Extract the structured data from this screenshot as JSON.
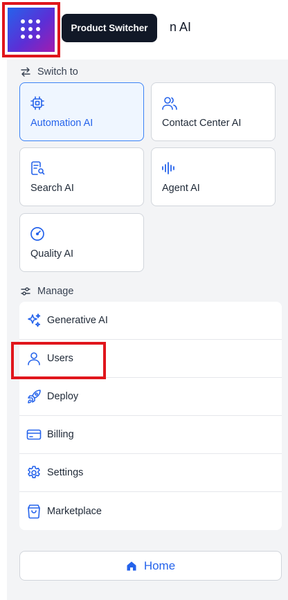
{
  "header": {
    "title_fragment": "n AI",
    "switcher_icon": "grid-dots-icon",
    "tooltip": "Product Switcher"
  },
  "switch_to": {
    "heading": "Switch to",
    "icon": "swap-arrows-icon",
    "products": [
      {
        "label": "Automation AI",
        "icon": "chip-icon",
        "active": true
      },
      {
        "label": "Contact Center AI",
        "icon": "users-icon",
        "active": false
      },
      {
        "label": "Search AI",
        "icon": "document-search-icon",
        "active": false
      },
      {
        "label": "Agent AI",
        "icon": "audio-wave-icon",
        "active": false
      },
      {
        "label": "Quality AI",
        "icon": "gauge-icon",
        "active": false
      }
    ]
  },
  "manage": {
    "heading": "Manage",
    "icon": "sliders-icon",
    "items": [
      {
        "label": "Generative AI",
        "icon": "sparkles-icon"
      },
      {
        "label": "Users",
        "icon": "user-icon"
      },
      {
        "label": "Deploy",
        "icon": "rocket-icon"
      },
      {
        "label": "Billing",
        "icon": "credit-card-icon"
      },
      {
        "label": "Settings",
        "icon": "gear-icon"
      },
      {
        "label": "Marketplace",
        "icon": "shopping-bag-icon"
      }
    ]
  },
  "home": {
    "label": "Home",
    "icon": "home-icon"
  },
  "colors": {
    "accent": "#2563eb",
    "highlight": "#e0161c",
    "tooltip_bg": "#111827",
    "panel_bg": "#f3f4f6"
  }
}
